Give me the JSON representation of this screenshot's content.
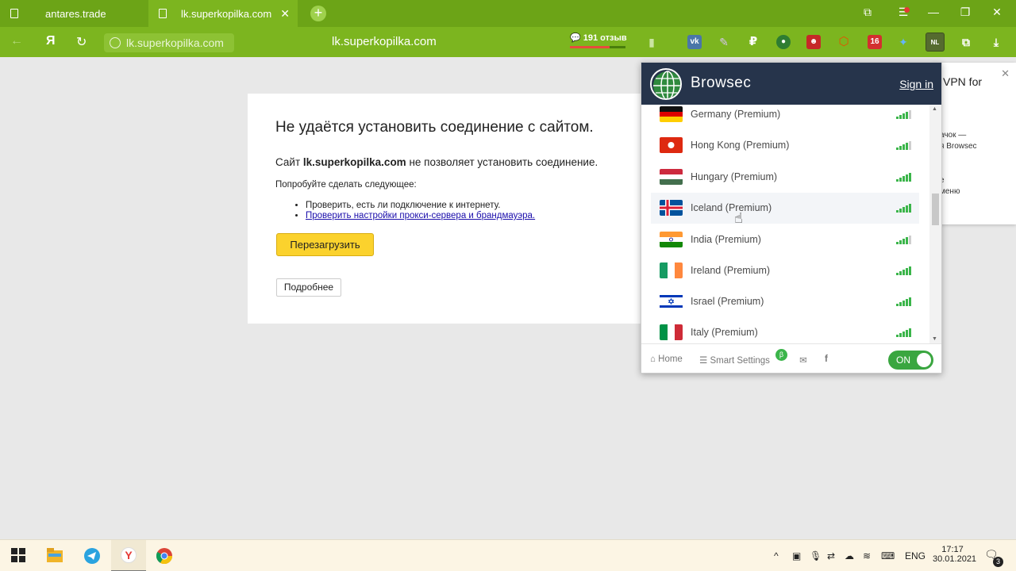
{
  "tabs": [
    {
      "title": "antares.trade"
    },
    {
      "title": "lk.superkopilka.com"
    }
  ],
  "addressbar": {
    "url_short": "lk.superkopilka.com",
    "url_center": "lk.superkopilka.com",
    "reviews": "191 отзыв"
  },
  "error": {
    "title": "Не удаётся установить соединение с сайтом.",
    "line_prefix": "Сайт ",
    "domain": "lk.superkopilka.com",
    "line_suffix": " не позволяет установить соединение.",
    "try_label": "Попробуйте сделать следующее:",
    "suggestions": [
      "Проверить, есть ли подключение к интернету.",
      "Проверить настройки прокси-сервера и брандмауэра."
    ],
    "reload_button": "Перезагрузить",
    "details_button": "Подробнее"
  },
  "notification": {
    "title": "VPN for",
    "line1": "ачок —",
    "line2": "я Browsec",
    "line3": "е",
    "line4": "меню"
  },
  "browsec": {
    "title": "Browsec",
    "signin": "Sign in",
    "countries": [
      {
        "name": "Germany (Premium)",
        "signal": 4
      },
      {
        "name": "Hong Kong (Premium)",
        "signal": 4
      },
      {
        "name": "Hungary (Premium)",
        "signal": 5
      },
      {
        "name": "Iceland (Premium)",
        "signal": 5,
        "hovered": true
      },
      {
        "name": "India (Premium)",
        "signal": 4
      },
      {
        "name": "Ireland (Premium)",
        "signal": 5
      },
      {
        "name": "Israel (Premium)",
        "signal": 5
      },
      {
        "name": "Italy (Premium)",
        "signal": 5
      }
    ],
    "footer": {
      "home": "Home",
      "smart_settings": "Smart Settings",
      "beta": "β",
      "toggle": "ON"
    }
  },
  "taskbar": {
    "lang": "ENG",
    "time": "17:17",
    "date": "30.01.2021",
    "notifications": "3"
  },
  "colors": {
    "tabbar": "#6ca417",
    "addressbar": "#7cb51f",
    "browsec_header": "#26344b",
    "signal": "#3bb54a",
    "toggle_on": "#3aa640"
  }
}
